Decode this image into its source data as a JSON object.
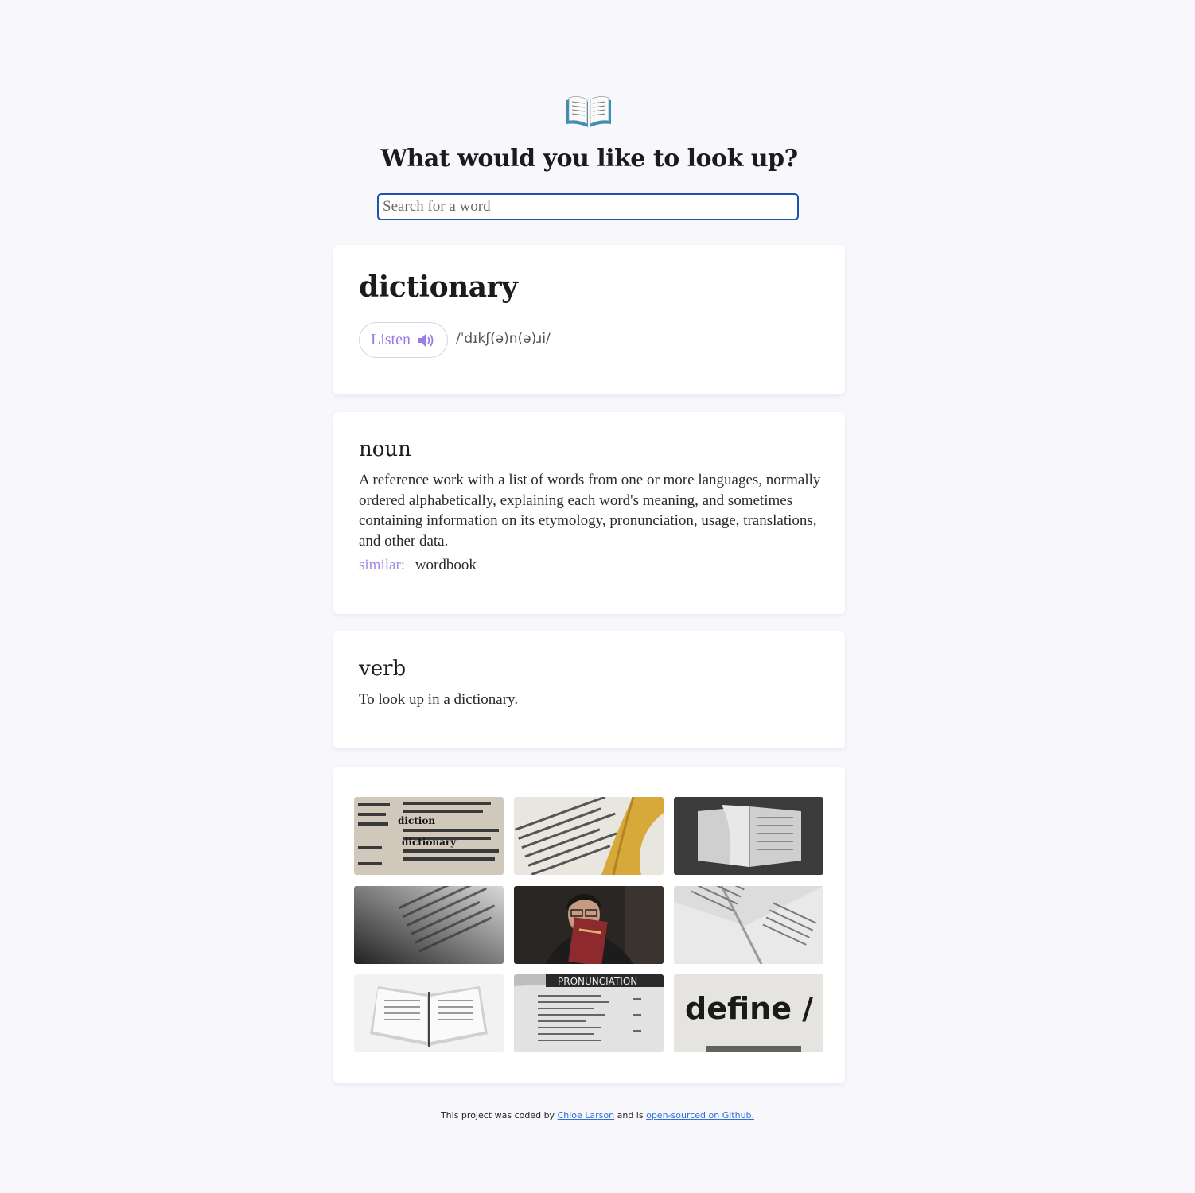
{
  "header": {
    "logo_icon": "open-book-icon",
    "title": "What would you like to look up?"
  },
  "search": {
    "placeholder": "Search for a word",
    "value": ""
  },
  "entry": {
    "word": "dictionary",
    "listen_label": "Listen",
    "listen_icon": "speaker-icon",
    "phonetic": "/ˈdɪkʃ(ə)n(ə)ɹi/"
  },
  "meanings": [
    {
      "part_of_speech": "noun",
      "definition": "A reference work with a list of words from one or more languages, normally ordered alphabetically, explaining each word's meaning, and sometimes containing information on its etymology, pronunciation, usage, translations, and other data.",
      "similar_label": "similar:",
      "synonyms": "wordbook"
    },
    {
      "part_of_speech": "verb",
      "definition": "To look up in a dictionary."
    }
  ],
  "photos": [
    {
      "alt": "dictionary page closeup"
    },
    {
      "alt": "dictionary with yellow tassel"
    },
    {
      "alt": "flipping dictionary pages"
    },
    {
      "alt": "dictionary page dark angle"
    },
    {
      "alt": "man holding red dictionary"
    },
    {
      "alt": "open book pages"
    },
    {
      "alt": "open book with pen"
    },
    {
      "alt": "pronunciation page"
    },
    {
      "alt": "define word closeup"
    }
  ],
  "photo_texts": {
    "pronunciation": "PRONUNCIATION",
    "define": "define /",
    "diction": "diction",
    "dictionary": "dictionary"
  },
  "footer": {
    "prefix": "This project was coded by",
    "author": "Chloe Larson",
    "middle": "and is",
    "repo_link": "open-sourced on Github."
  },
  "colors": {
    "accent": "#9b7be6",
    "link": "#2f6fdc",
    "search_border": "#1f4fb0",
    "background": "#f8f7fb"
  }
}
